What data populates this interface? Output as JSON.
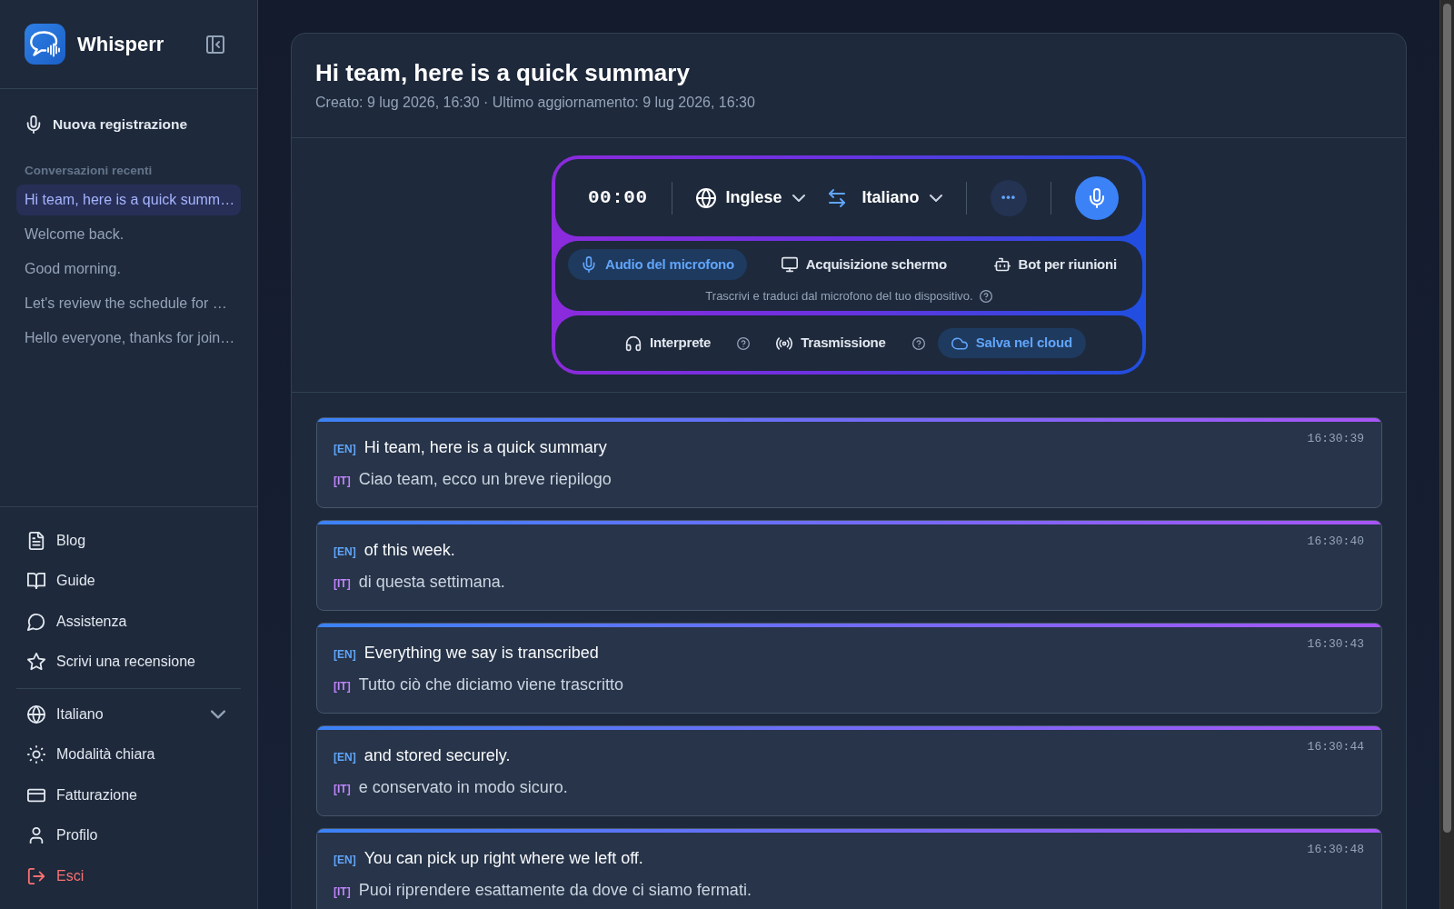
{
  "sidebar": {
    "brand": "Whisperr",
    "new_recording": "Nuova registrazione",
    "recent_heading": "Conversazioni recenti",
    "recent": [
      {
        "title": "Hi team, here is a quick summ…",
        "selected": true
      },
      {
        "title": "Welcome back.",
        "selected": false
      },
      {
        "title": "Good morning.",
        "selected": false
      },
      {
        "title": "Let's review the schedule for …",
        "selected": false
      },
      {
        "title": "Hello everyone, thanks for join…",
        "selected": false
      }
    ],
    "links": [
      "Blog",
      "Guide",
      "Assistenza",
      "Scrivi una recensione"
    ],
    "settings": [
      {
        "label": "Italiano",
        "kind": "dropdown"
      },
      {
        "label": "Modalità chiara",
        "kind": "link"
      },
      {
        "label": "Fatturazione",
        "kind": "link"
      },
      {
        "label": "Profilo",
        "kind": "link"
      },
      {
        "label": "Esci",
        "kind": "logout"
      }
    ]
  },
  "conversation": {
    "title": "Hi team, here is a quick summary",
    "meta": "Creato: 9 lug 2026, 16:30 · Ultimo aggiornamento: 9 lug 2026, 16:30"
  },
  "recorder": {
    "timer": "00:00",
    "source_language": "Inglese",
    "target_language": "Italiano",
    "sources": [
      {
        "label": "Audio del microfono",
        "selected": true
      },
      {
        "label": "Acquisizione schermo",
        "selected": false
      },
      {
        "label": "Bot per riunioni",
        "selected": false
      }
    ],
    "source_hint": "Trascrivi e traduci dal microfono del tuo dispositivo.",
    "options": [
      {
        "label": "Interprete",
        "on": false,
        "help_icon": true
      },
      {
        "label": "Trasmissione",
        "on": false,
        "help_icon": true
      },
      {
        "label": "Salva nel cloud",
        "on": true,
        "help_icon": false
      }
    ]
  },
  "transcript": [
    {
      "time": "16:30:39",
      "lines": [
        {
          "kind": "original",
          "tag": "[EN]",
          "text": "Hi team, here is a quick summary"
        },
        {
          "kind": "translation",
          "tag": "[IT]",
          "text": "Ciao team, ecco un breve riepilogo"
        }
      ]
    },
    {
      "time": "16:30:40",
      "lines": [
        {
          "kind": "original",
          "tag": "[EN]",
          "text": "of this week."
        },
        {
          "kind": "translation",
          "tag": "[IT]",
          "text": "di questa settimana."
        }
      ]
    },
    {
      "time": "16:30:43",
      "lines": [
        {
          "kind": "original",
          "tag": "[EN]",
          "text": "Everything we say is transcribed"
        },
        {
          "kind": "translation",
          "tag": "[IT]",
          "text": "Tutto ciò che diciamo viene trascritto"
        }
      ]
    },
    {
      "time": "16:30:44",
      "lines": [
        {
          "kind": "original",
          "tag": "[EN]",
          "text": "and stored securely."
        },
        {
          "kind": "translation",
          "tag": "[IT]",
          "text": "e conservato in modo sicuro."
        }
      ]
    },
    {
      "time": "16:30:48",
      "lines": [
        {
          "kind": "original",
          "tag": "[EN]",
          "text": "You can pick up right where we left off."
        },
        {
          "kind": "translation",
          "tag": "[IT]",
          "text": "Puoi riprendere esattamente da dove ci siamo fermati."
        }
      ]
    }
  ]
}
